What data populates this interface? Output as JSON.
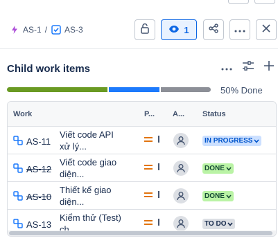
{
  "breadcrumb": {
    "parent": {
      "key": "AS-1",
      "icon": "subtask-icon"
    },
    "separator": "/",
    "current": {
      "key": "AS-3",
      "icon": "task-check-icon"
    }
  },
  "header": {
    "watch_count": "1"
  },
  "section": {
    "title": "Child work items"
  },
  "progress": {
    "label": "50% Done",
    "done": 0.5,
    "in_progress": 0.25,
    "todo": 0.25
  },
  "table": {
    "columns": [
      "Work",
      "P...",
      "A...",
      "Status"
    ],
    "rows": [
      {
        "key": "AS-11",
        "strike": false,
        "summary": "Viết code API xử lý...",
        "status": "IN PROGRESS",
        "status_kind": "progress"
      },
      {
        "key": "AS-12",
        "strike": true,
        "summary": "Viết code giao diện...",
        "status": "DONE",
        "status_kind": "done"
      },
      {
        "key": "AS-10",
        "strike": true,
        "summary": "Thiết kế giao diện...",
        "status": "DONE",
        "status_kind": "done"
      },
      {
        "key": "AS-13",
        "strike": false,
        "summary": "Kiểm thử (Test) ch...",
        "status": "TO DO",
        "status_kind": "todo"
      }
    ]
  },
  "colors": {
    "accent": "#0c66e4",
    "done": "#6a9a23",
    "in_progress": "#1d7afc",
    "todo": "#8c8f97",
    "priority": "#e2740f"
  }
}
